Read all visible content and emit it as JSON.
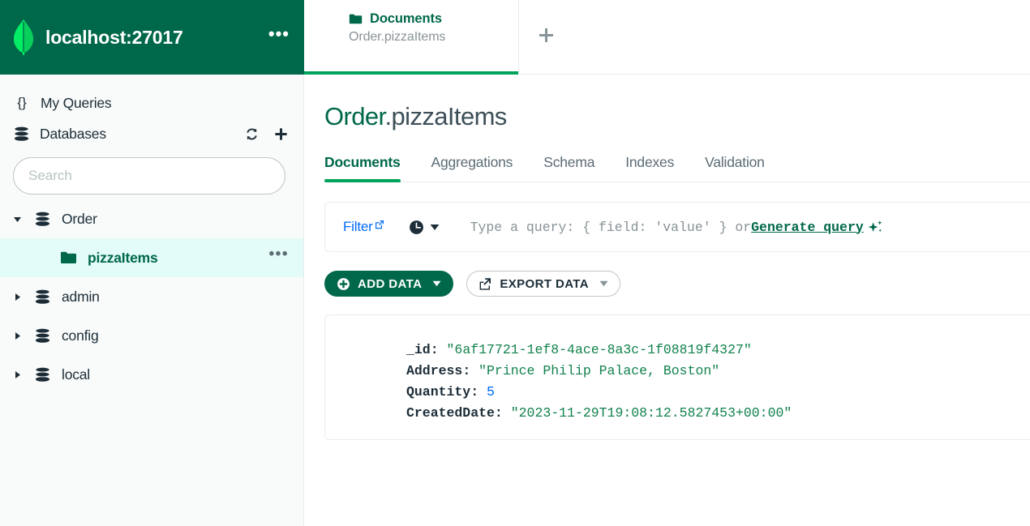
{
  "connection": {
    "title": "localhost:27017",
    "logo_icon": "mongodb-leaf-icon",
    "more_icon": "ellipsis-icon",
    "accent": "#00684A",
    "leaf_color": "#00ED64"
  },
  "tabs": {
    "items": [
      {
        "icon": "folder-icon",
        "title": "Documents",
        "subtitle": "Order.pizzaItems",
        "active": true
      }
    ],
    "new_tab_icon": "plus-icon"
  },
  "sidebar": {
    "my_queries": {
      "label": "My Queries",
      "icon": "curly-braces-icon"
    },
    "databases": {
      "label": "Databases",
      "icon": "database-icon",
      "refresh_icon": "refresh-icon",
      "add_icon": "plus-icon"
    },
    "search": {
      "placeholder": "Search",
      "value": ""
    },
    "tree": [
      {
        "label": "Order",
        "icon": "database-icon",
        "expanded": true,
        "type": "database"
      },
      {
        "label": "pizzaItems",
        "icon": "folder-icon",
        "type": "collection",
        "selected": true,
        "more_icon": "ellipsis-icon"
      },
      {
        "label": "admin",
        "icon": "database-icon",
        "expanded": false,
        "type": "database"
      },
      {
        "label": "config",
        "icon": "database-icon",
        "expanded": false,
        "type": "database"
      },
      {
        "label": "local",
        "icon": "database-icon",
        "expanded": false,
        "type": "database"
      }
    ]
  },
  "main": {
    "title_db": "Order",
    "title_collection": ".pizzaItems",
    "tabs": [
      {
        "label": "Documents",
        "active": true
      },
      {
        "label": "Aggregations",
        "active": false
      },
      {
        "label": "Schema",
        "active": false
      },
      {
        "label": "Indexes",
        "active": false
      },
      {
        "label": "Validation",
        "active": false
      }
    ],
    "filter_bar": {
      "filter_label": "Filter",
      "filter_external_icon": "external-link-icon",
      "history_icon": "clock-icon",
      "history_caret_icon": "chevron-down-icon",
      "query_placeholder_before": "Type a query: { field: 'value' } or ",
      "generate_query_label": "Generate query",
      "sparkle_icon": "sparkle-icon"
    },
    "buttons": {
      "add_data": {
        "label": "ADD DATA",
        "icon": "plus-circle-icon",
        "caret_icon": "chevron-down-icon"
      },
      "export_data": {
        "label": "EXPORT DATA",
        "icon": "export-icon",
        "caret_icon": "chevron-down-icon"
      }
    },
    "document": {
      "fields": [
        {
          "key": "_id",
          "value": "\"6af17721-1ef8-4ace-8a3c-1f08819f4327\"",
          "type": "string"
        },
        {
          "key": "Address",
          "value": "\"Prince Philip Palace, Boston\"",
          "type": "string"
        },
        {
          "key": "Quantity",
          "value": "5",
          "type": "number"
        },
        {
          "key": "CreatedDate",
          "value": "\"2023-11-29T19:08:12.5827453+00:00\"",
          "type": "string"
        }
      ]
    }
  },
  "colors": {
    "brand_green": "#00684A",
    "accent_green": "#00A35C",
    "leaf_green": "#00ED64",
    "selected_bg": "#E3FCF7",
    "link_blue": "#016BF8",
    "string_green": "#12824D",
    "sidebar_bg": "#F9FBFA",
    "border": "#E8EDEB"
  }
}
